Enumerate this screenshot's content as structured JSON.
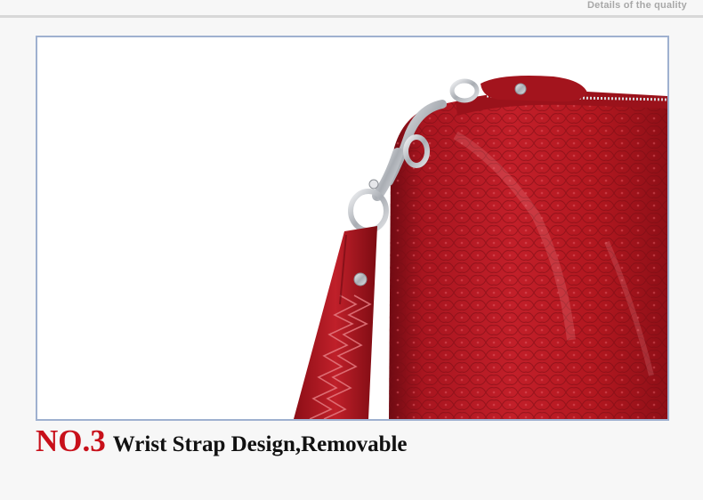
{
  "header": {
    "caption": "Details of the quality"
  },
  "photo": {
    "subject": "red-crocodile-leather-wallet-with-wrist-strap",
    "colors": {
      "leather": "#b01a22",
      "leather_dark": "#7a0d14",
      "metal": "#c9ccd0",
      "frame": "#9fb1d0"
    }
  },
  "caption": {
    "number": "NO.3",
    "text": "Wrist Strap Design,Removable",
    "number_color": "#c8101a"
  }
}
